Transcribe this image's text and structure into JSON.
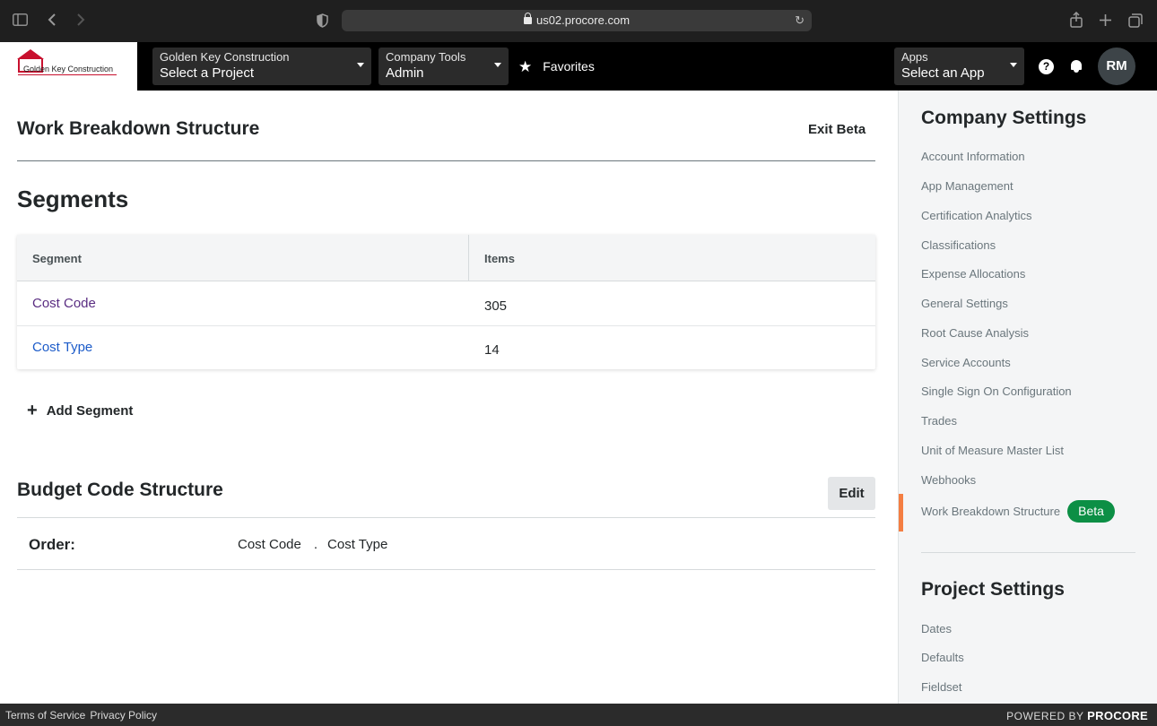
{
  "browser": {
    "url": "us02.procore.com",
    "icons": [
      "sidebar-toggle-icon",
      "back-icon",
      "forward-icon",
      "privacy-shield-icon",
      "lock-icon",
      "reload-icon",
      "share-icon",
      "new-tab-icon",
      "tabs-overview-icon"
    ]
  },
  "header": {
    "logo_text": "Golden Key Construction",
    "company_selector": {
      "top": "Golden Key Construction",
      "bottom": "Select a Project"
    },
    "tools_selector": {
      "top": "Company Tools",
      "bottom": "Admin"
    },
    "favorites_label": "Favorites",
    "apps_selector": {
      "top": "Apps",
      "bottom": "Select an App"
    },
    "help_glyph": "?",
    "avatar_initials": "RM"
  },
  "main": {
    "page_title": "Work Breakdown Structure",
    "exit_beta_label": "Exit Beta",
    "segments_title": "Segments",
    "table": {
      "columns": [
        "Segment",
        "Items"
      ],
      "rows": [
        {
          "segment": "Cost Code",
          "items": "305"
        },
        {
          "segment": "Cost Type",
          "items": "14"
        }
      ]
    },
    "add_segment_label": "Add Segment",
    "budget_code_title": "Budget Code Structure",
    "edit_label": "Edit",
    "order_label": "Order:",
    "order_parts": [
      "Cost Code",
      ".",
      "Cost Type"
    ]
  },
  "sidebar": {
    "company_heading": "Company Settings",
    "company_items": [
      "Account Information",
      "App Management",
      "Certification Analytics",
      "Classifications",
      "Expense Allocations",
      "General Settings",
      "Root Cause Analysis",
      "Service Accounts",
      "Single Sign On Configuration",
      "Trades",
      "Unit of Measure Master List",
      "Webhooks",
      "Work Breakdown Structure"
    ],
    "beta_badge": "Beta",
    "project_heading": "Project Settings",
    "project_items": [
      "Dates",
      "Defaults",
      "Fieldset"
    ]
  },
  "footer": {
    "terms": "Terms of Service",
    "privacy": "Privacy Policy",
    "powered_by": "POWERED BY",
    "brand": "PROCORE"
  },
  "colors": {
    "link": "#1d5cc9",
    "visited_link": "#5a2d82",
    "active_indicator": "#f47e42",
    "beta_badge": "#0c8f45"
  }
}
